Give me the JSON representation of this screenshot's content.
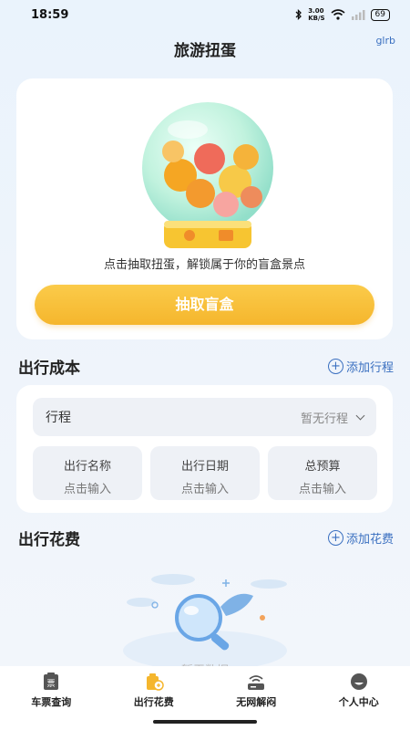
{
  "status": {
    "time": "18:59",
    "speed_top": "3.00",
    "speed_bottom": "KB/S",
    "battery": "69"
  },
  "header": {
    "title": "旅游扭蛋",
    "corner_link": "glrb"
  },
  "gacha": {
    "hint": "点击抽取扭蛋，解锁属于你的盲盒景点",
    "button_label": "抽取盲盒"
  },
  "cost_section": {
    "title": "出行成本",
    "add_label": "添加行程",
    "trip_label": "行程",
    "trip_value": "暂无行程",
    "fields": [
      {
        "label": "出行名称",
        "placeholder": "点击输入"
      },
      {
        "label": "出行日期",
        "placeholder": "点击输入"
      },
      {
        "label": "总预算",
        "placeholder": "点击输入"
      }
    ]
  },
  "spend_section": {
    "title": "出行花费",
    "add_label": "添加花费",
    "empty_text": "暂无数据"
  },
  "tabs": [
    {
      "label": "车票查询",
      "icon": "ticket-icon"
    },
    {
      "label": "出行花费",
      "icon": "wallet-icon",
      "active": true
    },
    {
      "label": "无网解闷",
      "icon": "router-icon"
    },
    {
      "label": "个人中心",
      "icon": "profile-icon"
    }
  ],
  "colors": {
    "accent": "#3a6fc0",
    "button": "#f5b62d",
    "active_tab": "#f5b62d"
  }
}
